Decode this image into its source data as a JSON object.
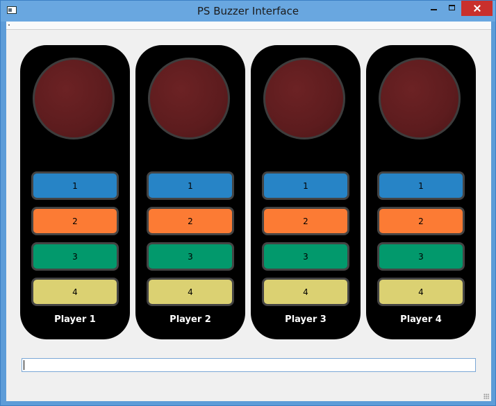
{
  "window": {
    "title": "PS Buzzer Interface"
  },
  "players": [
    {
      "name": "Player 1",
      "buttons": [
        "1",
        "2",
        "3",
        "4"
      ]
    },
    {
      "name": "Player 2",
      "buttons": [
        "1",
        "2",
        "3",
        "4"
      ]
    },
    {
      "name": "Player 3",
      "buttons": [
        "1",
        "2",
        "3",
        "4"
      ]
    },
    {
      "name": "Player 4",
      "buttons": [
        "1",
        "2",
        "3",
        "4"
      ]
    }
  ],
  "colors": {
    "buzzer": "#5d1c1e",
    "button_1": "#2784c6",
    "button_2": "#fc7b34",
    "button_3": "#02996c",
    "button_4": "#dbd172",
    "pad": "#000000"
  },
  "input": {
    "value": ""
  }
}
